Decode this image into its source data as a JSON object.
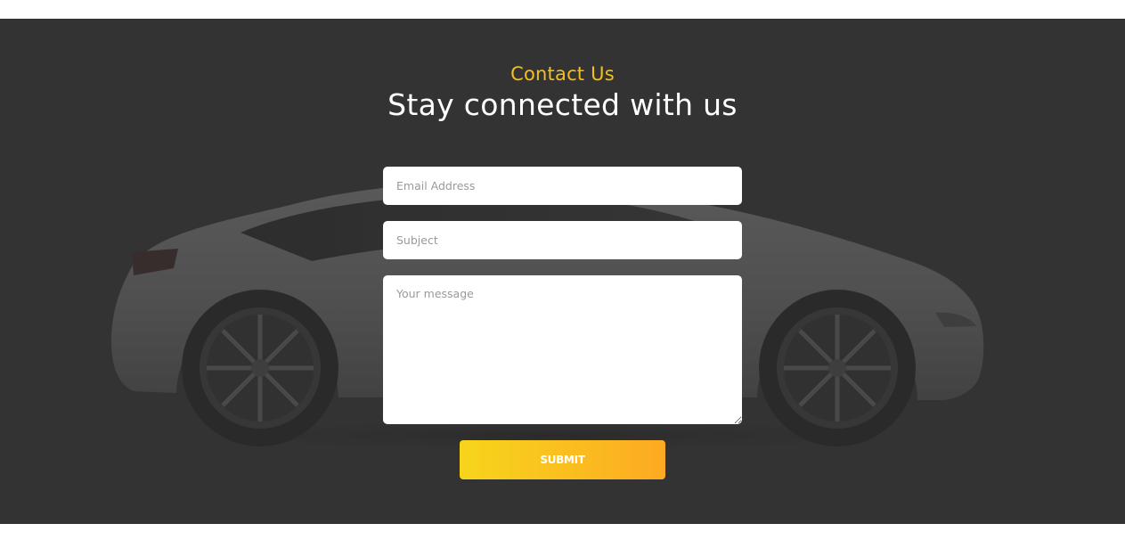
{
  "contact": {
    "eyebrow": "Contact Us",
    "heading": "Stay connected with us"
  },
  "form": {
    "email_placeholder": "Email Address",
    "subject_placeholder": "Subject",
    "message_placeholder": "Your message",
    "submit_label": "SUBMIT"
  },
  "colors": {
    "accent": "#f5bf1b",
    "section_bg": "#343434",
    "button_gradient_start": "#f7d51b",
    "button_gradient_end": "#fdaa22"
  },
  "icons": {
    "background": "car-silhouette-image",
    "textarea_resize": "resize-grip-icon"
  }
}
